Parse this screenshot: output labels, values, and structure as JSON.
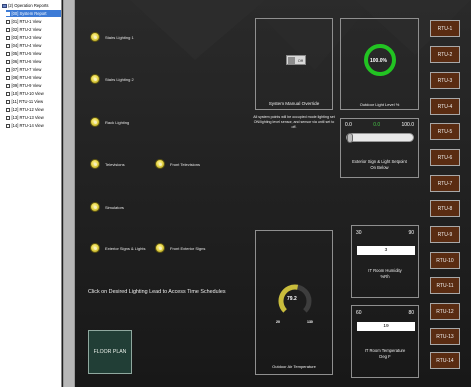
{
  "sidebar": {
    "root_label": "(2) Operation Reports",
    "items": [
      {
        "label": "[00] System Report",
        "selected": true
      },
      {
        "label": "[01] RTU-1 View"
      },
      {
        "label": "[02] RTU-2 View"
      },
      {
        "label": "[03] RTU-3 View"
      },
      {
        "label": "[04] RTU-4 View"
      },
      {
        "label": "[05] RTU-5 View"
      },
      {
        "label": "[06] RTU-6 View"
      },
      {
        "label": "[07] RTU-7 View"
      },
      {
        "label": "[08] RTU-8 View"
      },
      {
        "label": "[09] RTU-9 View"
      },
      {
        "label": "[10] RTU-10 View"
      },
      {
        "label": "[11] RTU-11 View"
      },
      {
        "label": "[12] RTU-12 View"
      },
      {
        "label": "[13] RTU-13 View"
      },
      {
        "label": "[14] RTU-14 View"
      }
    ]
  },
  "lighting": {
    "items": [
      {
        "label": "Stairs Lighting 1"
      },
      {
        "label": "Stairs Lighting 2"
      },
      {
        "label": "Rack Lighting"
      },
      {
        "label": "Televisions"
      },
      {
        "label": "Front Televisions"
      },
      {
        "label": "Simulators"
      },
      {
        "label": "Exterior Signs & Lights"
      },
      {
        "label": "Front Exterior Signs"
      }
    ],
    "instruction": "Click on Desired Lighting Lead to Access Time Schedules",
    "floor_plan_button": "FLOOR PLAN"
  },
  "override": {
    "toggle_label": "Off",
    "title": "System Manual Override",
    "description": "All system points will be occupied mode lighting set ON/lighting level sensor, and sensor via until set to off."
  },
  "outdoor_light": {
    "value": "100.0%",
    "percent": 100,
    "caption": "Outdoor Light Level %"
  },
  "setpoint": {
    "min": "0.0",
    "current": "0.0",
    "max": "100.0",
    "position": 0,
    "caption_line1": "Exterior Sign & Light Setpoint",
    "caption_line2": "On Below"
  },
  "it_humidity": {
    "min": "30",
    "max": "90",
    "value": "3",
    "caption_line1": "IT Room Humidity",
    "caption_line2": "%Rh"
  },
  "outdoor_temp": {
    "value": "79.2",
    "min": "20",
    "max": "130",
    "fraction": 0.54,
    "caption": "Outdoor Air Temperature"
  },
  "it_temp": {
    "min": "60",
    "max": "80",
    "value": "19",
    "caption_line1": "IT Room Temperature",
    "caption_line2": "Deg F"
  },
  "rtu_buttons": [
    "RTU-1",
    "RTU-2",
    "RTU-3",
    "RTU-4",
    "RTU-5",
    "RTU-6",
    "RTU-7",
    "RTU-8",
    "RTU-9",
    "RTU-10",
    "RTU-11",
    "RTU-12",
    "RTU-13",
    "RTU-14"
  ],
  "colors": {
    "gauge_green": "#22c322",
    "gauge_gold": "#c9bd3c",
    "rtu_brown": "#5a2c12",
    "selected_blue": "#3d7bd6"
  }
}
